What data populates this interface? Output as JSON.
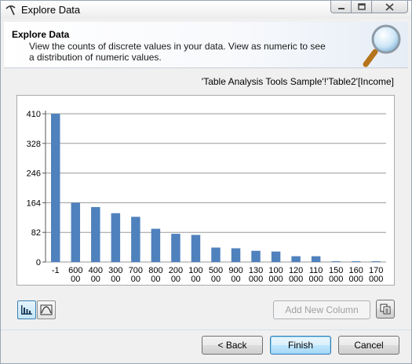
{
  "window": {
    "title": "Explore Data",
    "icon": "pickaxe-icon",
    "controls": [
      "minimize-icon",
      "maximize-icon",
      "close-icon"
    ]
  },
  "header": {
    "title": "Explore Data",
    "description": "View the counts of discrete values in your data.  View as numeric to see a distribution of numeric values.",
    "icon": "magnifier-icon"
  },
  "source_path": "'Table Analysis Tools Sample'!'Table2'[Income]",
  "chart_data": {
    "type": "bar",
    "categories": [
      "-1",
      "600\n00",
      "400\n00",
      "300\n00",
      "700\n00",
      "800\n00",
      "200\n00",
      "100\n00",
      "500\n00",
      "900\n00",
      "130\n000",
      "100\n000",
      "120\n000",
      "110\n000",
      "150\n000",
      "160\n000",
      "170\n000"
    ],
    "values": [
      410,
      164,
      152,
      135,
      125,
      92,
      78,
      75,
      40,
      38,
      31,
      29,
      16,
      16,
      2,
      2,
      2
    ],
    "yticks": [
      0,
      82,
      164,
      246,
      328,
      410
    ],
    "ylim": [
      0,
      410
    ],
    "grid": true,
    "bar_color": "#4f81bd"
  },
  "toolbar": {
    "discrete_view": "bar-chart-icon",
    "numeric_view": "curve-chart-icon"
  },
  "buttons": {
    "add_column": "Add New Column",
    "copy": "copy-icon",
    "back": "< Back",
    "finish": "Finish",
    "cancel": "Cancel"
  }
}
